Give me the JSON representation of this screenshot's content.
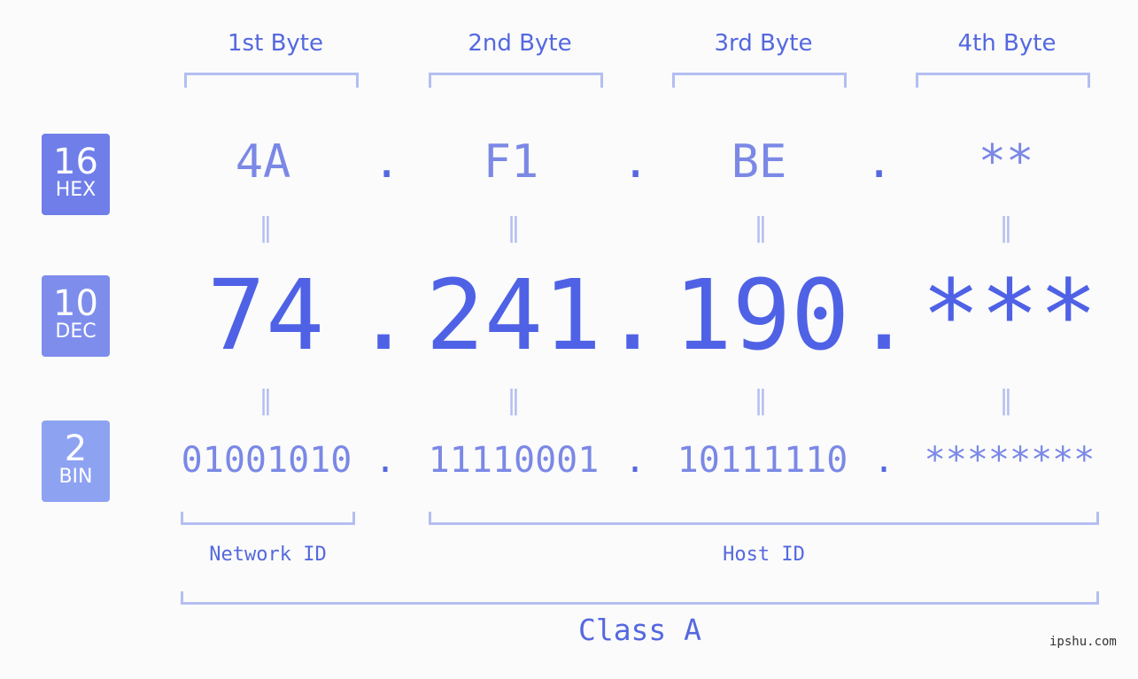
{
  "colors": {
    "accent": "#4f62e6",
    "hex_badge": "#6f7ee8",
    "dec_badge": "#7e8dec",
    "bin_badge": "#8ea2f2",
    "bracket": "#b4bef2"
  },
  "headers": [
    "1st Byte",
    "2nd Byte",
    "3rd Byte",
    "4th Byte"
  ],
  "badges": {
    "hex": {
      "num": "16",
      "label": "HEX"
    },
    "dec": {
      "num": "10",
      "label": "DEC"
    },
    "bin": {
      "num": "2",
      "label": "BIN"
    }
  },
  "hex": [
    "4A",
    "F1",
    "BE",
    "**"
  ],
  "dec": [
    "74",
    "241",
    "190",
    "***"
  ],
  "bin": [
    "01001010",
    "11110001",
    "10111110",
    "********"
  ],
  "separator": ".",
  "equals": "=",
  "labels": {
    "network_id": "Network ID",
    "host_id": "Host ID",
    "class": "Class A"
  },
  "watermark": "ipshu.com"
}
